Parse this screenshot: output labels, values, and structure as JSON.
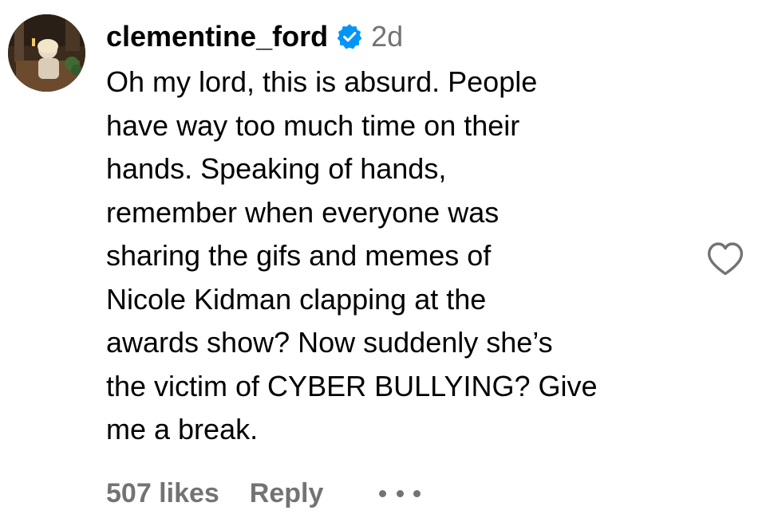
{
  "comment": {
    "username": "clementine_ford",
    "verified": true,
    "timestamp": "2d",
    "text_lines": [
      "Oh my lord, this is absurd. People",
      "have way too much time on their",
      "hands. Speaking of hands,",
      "remember when everyone was",
      "sharing the gifs and memes of",
      "Nicole Kidman clapping at the",
      "awards show? Now suddenly she’s",
      "the victim of CYBER BULLYING? Give",
      "me a break."
    ],
    "likes_label": "507 likes",
    "reply_label": "Reply",
    "like_icon": "heart-outline-icon",
    "more_icon": "more-horizontal-icon",
    "verified_icon": "verified-badge-icon"
  },
  "colors": {
    "text": "#000000",
    "secondary": "#737373",
    "verified_blue": "#0095f6",
    "background": "#ffffff"
  }
}
